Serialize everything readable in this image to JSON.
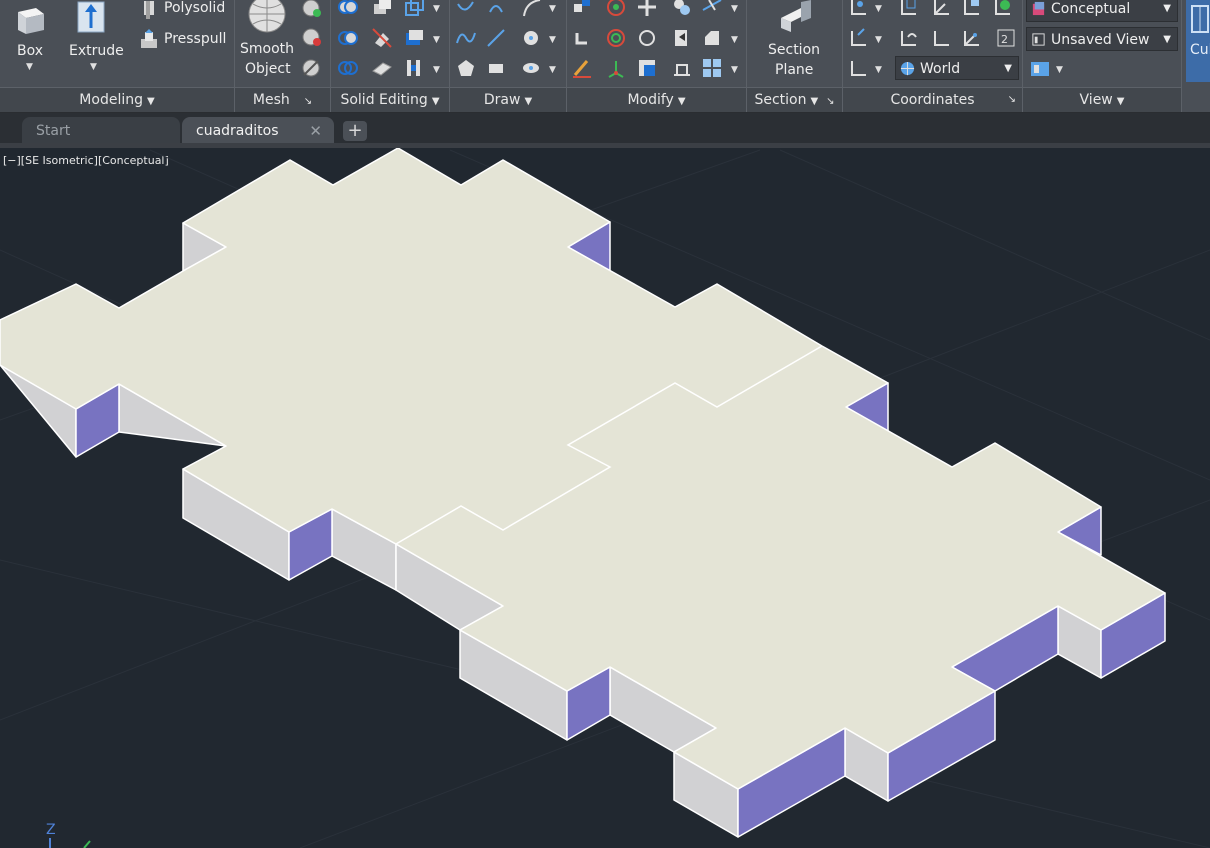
{
  "ribbon": {
    "modeling": {
      "label": "Modeling",
      "box": "Box",
      "extrude": "Extrude",
      "polysolid": "Polysolid",
      "presspull": "Presspull"
    },
    "mesh": {
      "label": "Mesh",
      "smooth_line1": "Smooth",
      "smooth_line2": "Object"
    },
    "solid_editing": {
      "label": "Solid Editing"
    },
    "draw": {
      "label": "Draw"
    },
    "modify": {
      "label": "Modify"
    },
    "section": {
      "label": "Section",
      "plane_line1": "Section",
      "plane_line2": "Plane"
    },
    "coordinates": {
      "label": "Coordinates",
      "ucs": "World"
    },
    "view": {
      "label": "View",
      "visual_style": "Conceptual",
      "named_view": "Unsaved View"
    },
    "culling": {
      "label": "Cul"
    }
  },
  "tabs": [
    {
      "label": "Start",
      "active": false
    },
    {
      "label": "cuadraditos",
      "active": true
    }
  ],
  "viewport": {
    "label": "[−][SE Isometric][Conceptual]",
    "axis_z": "Z"
  },
  "colors": {
    "top_face": "#e4e4d6",
    "left_face": "#d1d1d3",
    "right_face": "#7873c1",
    "edge": "#ffffff",
    "background": "#212830",
    "grid": "#2a313a"
  }
}
